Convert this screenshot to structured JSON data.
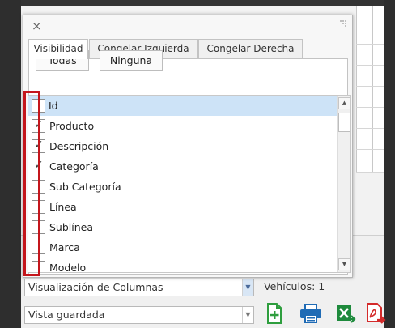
{
  "dialog": {
    "close_symbol": "×",
    "tabs": [
      {
        "label": "Visibilidad",
        "active": true
      },
      {
        "label": "Congelar Izquierda",
        "active": false
      },
      {
        "label": "Congelar Derecha",
        "active": false
      }
    ],
    "buttons": {
      "all": "Todas",
      "none": "Ninguna"
    },
    "columns": [
      {
        "label": "Id",
        "checked": false,
        "selected": true
      },
      {
        "label": "Producto",
        "checked": true,
        "selected": false
      },
      {
        "label": "Descripción",
        "checked": true,
        "selected": false
      },
      {
        "label": "Categoría",
        "checked": true,
        "selected": false
      },
      {
        "label": "Sub Categoría",
        "checked": false,
        "selected": false
      },
      {
        "label": "Línea",
        "checked": false,
        "selected": false
      },
      {
        "label": "Sublínea",
        "checked": false,
        "selected": false
      },
      {
        "label": "Marca",
        "checked": false,
        "selected": false
      },
      {
        "label": "Modelo",
        "checked": false,
        "selected": false
      }
    ],
    "highlight_color": "#c4161c"
  },
  "footer": {
    "column_view_combo": "Visualización de Columnas",
    "saved_view_combo": "Vista guardada",
    "vehicles_label": "Vehículos: 1",
    "actions": [
      {
        "name": "new-document-icon",
        "color": "#2e9e3e"
      },
      {
        "name": "print-icon",
        "color": "#1f6bb5"
      },
      {
        "name": "excel-export-icon",
        "color": "#1e8a3c"
      },
      {
        "name": "pdf-export-icon",
        "color": "#d42a2a"
      }
    ]
  }
}
